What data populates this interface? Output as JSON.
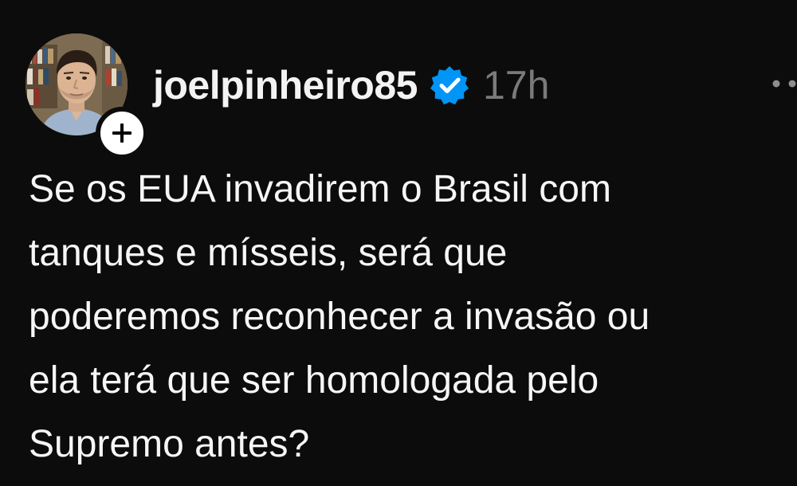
{
  "post": {
    "author": {
      "username": "joelpinheiro85",
      "verified": true,
      "avatar_icon": "avatar-photo"
    },
    "timestamp": "17h",
    "follow_icon": "plus-icon",
    "more_icon": "more-dots-icon",
    "text_lines": [
      "Se os EUA invadirem o Brasil com",
      "tanques e mísseis, será que",
      "poderemos reconhecer a invasão ou",
      "ela terá que ser homologada pelo",
      "Supremo antes?"
    ]
  },
  "colors": {
    "background": "#0c0c0c",
    "text": "#f3f3f3",
    "muted": "#7a7a7a",
    "verified_blue": "#0095f6"
  }
}
